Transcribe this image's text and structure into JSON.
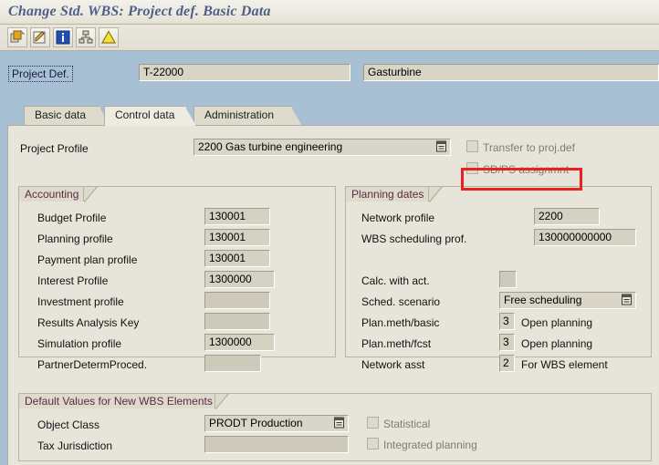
{
  "window": {
    "title": "Change Std. WBS: Project def. Basic Data"
  },
  "toolbar": {
    "buttons": [
      {
        "name": "copy-reference-icon",
        "tooltip": "Create with reference"
      },
      {
        "name": "edit-pencil-icon",
        "tooltip": "Edit"
      },
      {
        "name": "info-icon",
        "tooltip": "Information"
      },
      {
        "name": "hierarchy-icon",
        "tooltip": "Project hierarchy"
      },
      {
        "name": "warning-triangle-icon",
        "tooltip": "Messages"
      }
    ]
  },
  "header": {
    "project_def_label": "Project Def.",
    "project_def_key": "T-22000",
    "project_def_desc": "Gasturbine"
  },
  "tabs": [
    {
      "label": "Basic data",
      "active": false
    },
    {
      "label": "Control data",
      "active": true
    },
    {
      "label": "Administration",
      "active": false
    }
  ],
  "control_data": {
    "project_profile": {
      "label": "Project Profile",
      "value": "2200 Gas turbine engineering"
    },
    "top_checkboxes": [
      {
        "label": "Transfer to proj.def",
        "checked": false
      },
      {
        "label": "SD/PS assignmnt",
        "checked": false,
        "highlighted": true
      }
    ],
    "accounting": {
      "title": "Accounting",
      "fields": [
        {
          "label": "Budget Profile",
          "value": "130001"
        },
        {
          "label": "Planning profile",
          "value": "130001"
        },
        {
          "label": "Payment plan profile",
          "value": "130001"
        },
        {
          "label": "Interest Profile",
          "value": "1300000"
        },
        {
          "label": "Investment profile",
          "value": ""
        },
        {
          "label": "Results Analysis Key",
          "value": ""
        },
        {
          "label": "Simulation profile",
          "value": "1300000"
        },
        {
          "label": "PartnerDetermProced.",
          "value": ""
        }
      ]
    },
    "planning_dates": {
      "title": "Planning dates",
      "fields": [
        {
          "label": "Network profile",
          "value": "2200"
        },
        {
          "label": "WBS scheduling prof.",
          "value": "130000000000"
        }
      ],
      "calc_with_act": {
        "label": "Calc. with act.",
        "value": ""
      },
      "sched_scenario": {
        "label": "Sched. scenario",
        "value": "Free scheduling"
      },
      "coded_fields": [
        {
          "label": "Plan.meth/basic",
          "code": "3",
          "desc": "Open planning"
        },
        {
          "label": "Plan.meth/fcst",
          "code": "3",
          "desc": "Open planning"
        },
        {
          "label": "Network asst",
          "code": "2",
          "desc": "For WBS element"
        }
      ]
    },
    "defaults": {
      "title": "Default Values for New WBS Elements",
      "fields": [
        {
          "label": "Object Class",
          "value": "PRODT Production",
          "has_dropdown": true
        },
        {
          "label": "Tax Jurisdiction",
          "value": "",
          "has_dropdown": false
        }
      ],
      "checkboxes": [
        {
          "label": "Statistical",
          "checked": false
        },
        {
          "label": "Integrated planning",
          "checked": false
        }
      ]
    }
  },
  "colors": {
    "app_background": "#a8c0d4",
    "panel_background": "#e7e4da",
    "title_text": "#4e5f8a",
    "group_title_text": "#5c2a44",
    "annotation": "#e8221d",
    "input_background": "#d5d1c3"
  }
}
